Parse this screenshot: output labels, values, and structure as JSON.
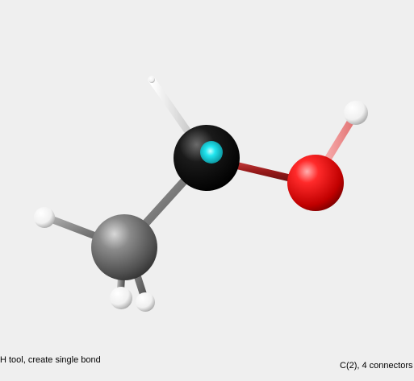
{
  "viewer": {
    "background": "#efefef",
    "atom_colors": {
      "carbon": "#555555",
      "carbon_selected": "#000000",
      "selection_highlight": "#22e6f0",
      "oxygen": "#ee1111",
      "hydrogen": "#ffffff"
    },
    "bond_colors": {
      "default": "#8a8a8a",
      "carbon_oxygen": "#aa2222",
      "oxygen_hydrogen": "#ff9a9a",
      "hydrogen": "#dddddd"
    }
  },
  "status": {
    "tool_hint": "H tool, create single bond",
    "selection_info": "C(2), 4 connectors"
  }
}
